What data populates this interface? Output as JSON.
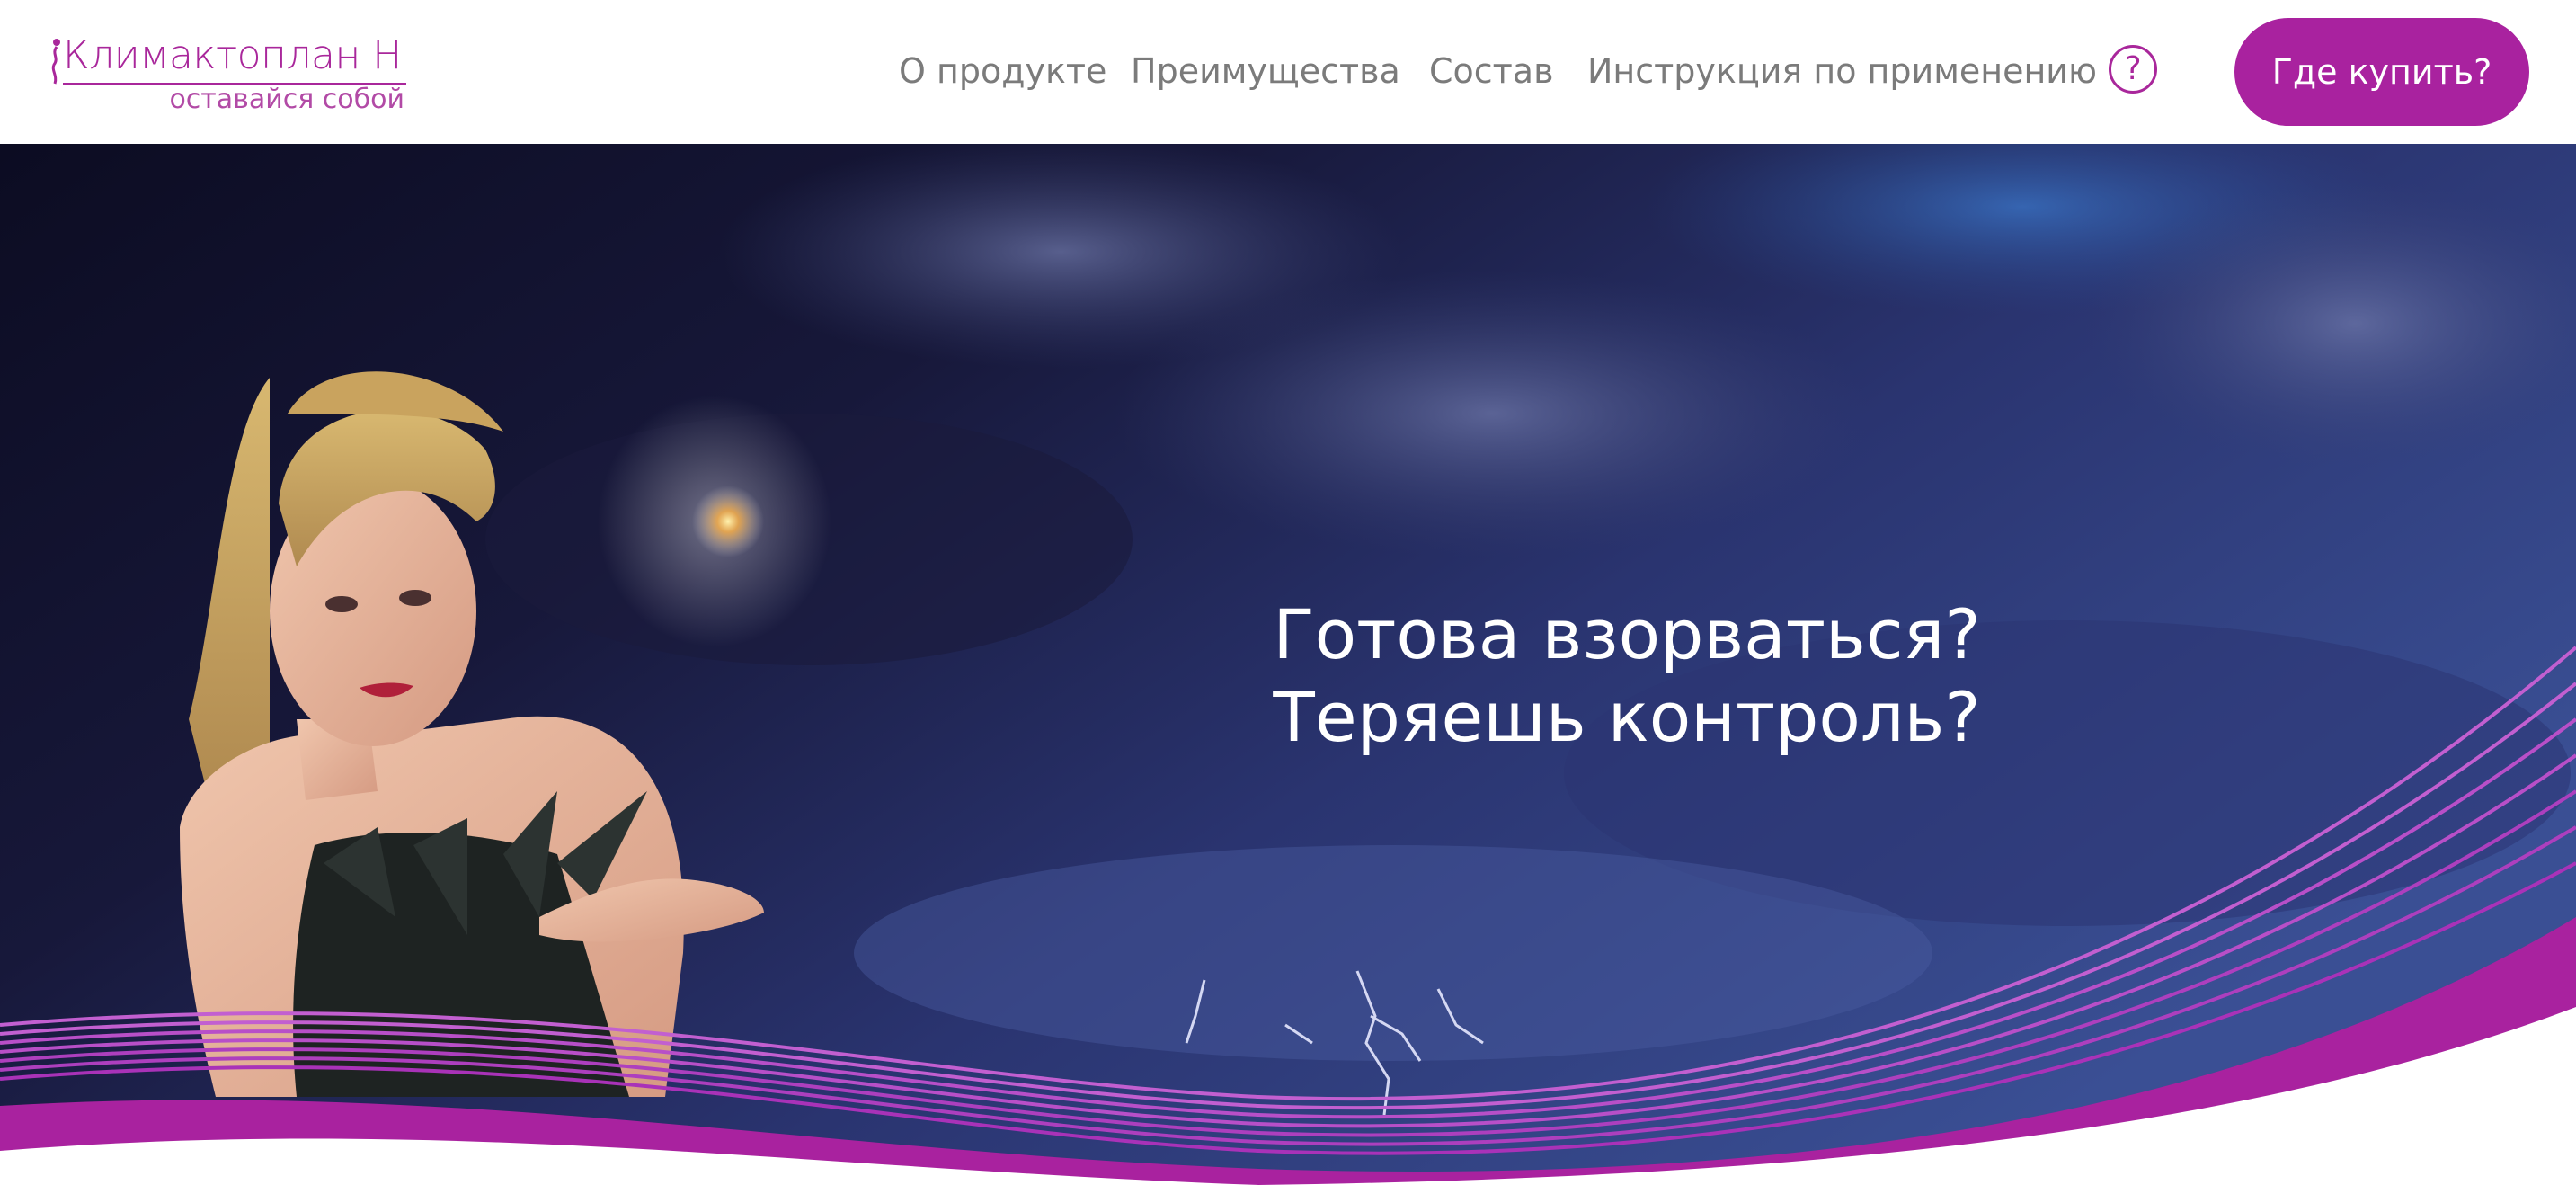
{
  "header": {
    "logo": {
      "title": "Климактоплан Н",
      "tagline": "оставайся собой"
    },
    "nav": [
      {
        "label": "О продукте"
      },
      {
        "label": "Преимущества"
      },
      {
        "label": "Состав"
      },
      {
        "label": "Инструкция по применению"
      }
    ],
    "help_label": "?",
    "buy_label": "Где купить?"
  },
  "hero": {
    "headline_line1": "Готова взорваться?",
    "headline_line2": "Теряешь контроль?"
  },
  "colors": {
    "brand": "#a9229f",
    "nav_text": "#7b7b7b",
    "sky_dark": "#14132e",
    "sky_light": "#3b4a8a"
  },
  "icons": [
    "woman-silhouette-icon",
    "question-icon"
  ]
}
